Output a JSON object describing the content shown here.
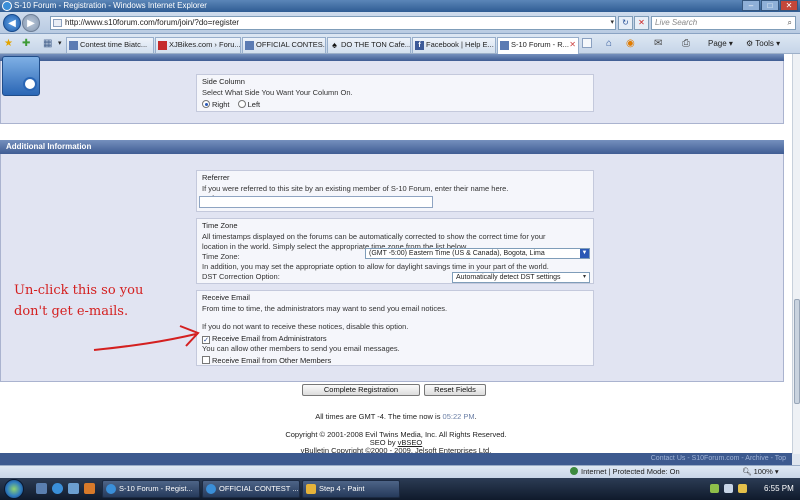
{
  "window": {
    "title": "S-10 Forum - Registration - Windows Internet Explorer"
  },
  "address": {
    "url": "http://www.s10forum.com/forum/join/?do=register",
    "search_placeholder": "Live Search",
    "refresh_icon": "refresh-icon",
    "stop_icon": "stop-icon"
  },
  "tabs": [
    {
      "label": "Contest time Biatc...",
      "icon": "forum-favicon"
    },
    {
      "label": "XJBikes.com › Foru...",
      "icon": "xj-favicon"
    },
    {
      "label": "OFFICIAL CONTES...",
      "icon": "forum-favicon"
    },
    {
      "label": "DO THE TON Cafe...",
      "icon": "spade-favicon"
    },
    {
      "label": "Facebook | Help E...",
      "icon": "facebook-favicon"
    },
    {
      "label": "S-10 Forum - R...",
      "icon": "forum-favicon",
      "active": true
    }
  ],
  "commands": {
    "page": "Page",
    "tools": "Tools"
  },
  "side_column": {
    "legend": "Side Column",
    "description": "Select What Side You Want Your Column On.",
    "options": [
      "Right",
      "Left"
    ],
    "selected": "Right"
  },
  "additional_info": {
    "header": "Additional Information",
    "referrer": {
      "legend": "Referrer",
      "description": "If you were referred to this site by an existing member of S-10 Forum, enter their name here.",
      "label": "Referrer:",
      "value": ""
    },
    "time_zone": {
      "legend": "Time Zone",
      "description_1": "All timestamps displayed on the forums can be automatically corrected to show the correct time for your",
      "description_2": "location in the world. Simply select the appropriate time zone from the list below.",
      "label": "Time Zone:",
      "selected": "(GMT -5:00) Eastern Time (US & Canada), Bogota, Lima",
      "dst_note": "In addition, you may set the appropriate option to allow for daylight savings time in your part of the world.",
      "dst_label": "DST Correction Option:",
      "dst_selected": "Automatically detect DST settings"
    },
    "receive_email": {
      "legend": "Receive Email",
      "description": "From time to time, the administrators may want to send you email notices.",
      "disable_note": "If you do not want to receive these notices, disable this option.",
      "admin_label": "Receive Email from Administrators",
      "admin_checked": true,
      "members_note": "You can allow other members to send you email messages.",
      "members_label": "Receive Email from Other Members",
      "members_checked": false
    }
  },
  "buttons": {
    "complete": "Complete Registration",
    "reset": "Reset Fields"
  },
  "footer": {
    "times_prefix": "All times are GMT -4. The time now is ",
    "time_now": "05:22 PM",
    "times_suffix": ".",
    "copyright": "Copyright © 2001-2008 Evil Twins Media, Inc. All Rights Reserved.",
    "seo_prefix": "SEO by ",
    "seo_link": "vBSEO",
    "vbulletin": "vBulletin Copyright ©2000 - 2009, Jelsoft Enterprises Ltd.",
    "bottom_links": "Contact Us - S10Forum.com - Archive - Top"
  },
  "annotation": {
    "line1": "Un-click this so you",
    "line2": "don't get e-mails.",
    "color": "#d42020"
  },
  "status": {
    "zone": "Internet | Protected Mode: On",
    "zoom": "100%"
  },
  "taskbar": {
    "tasks": [
      {
        "label": "S-10 Forum - Regist...",
        "icon": "ie-icon"
      },
      {
        "label": "OFFICIAL CONTEST ...",
        "icon": "ie-icon"
      },
      {
        "label": "Step 4 - Paint",
        "icon": "paint-icon"
      }
    ],
    "clock": "6:55 PM"
  }
}
